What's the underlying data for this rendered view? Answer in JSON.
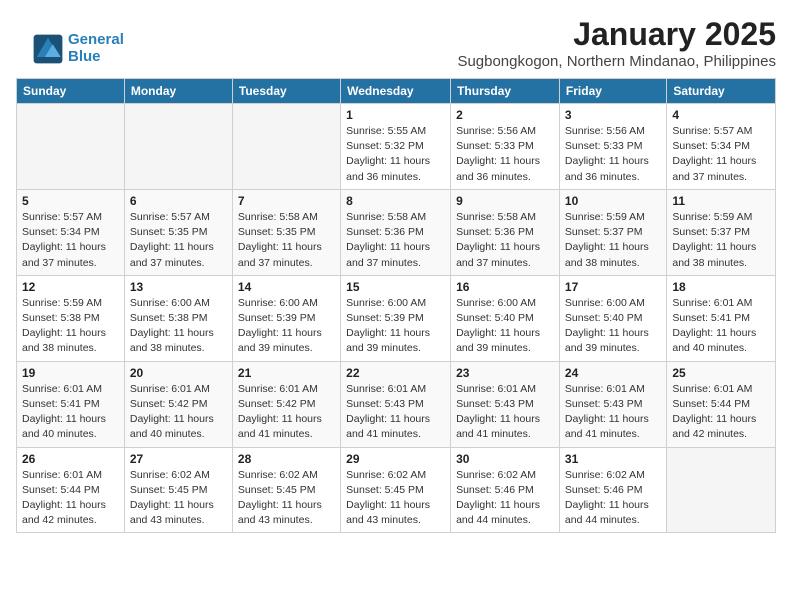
{
  "logo": {
    "line1": "General",
    "line2": "Blue"
  },
  "header": {
    "month_year": "January 2025",
    "location": "Sugbongkogon, Northern Mindanao, Philippines"
  },
  "weekdays": [
    "Sunday",
    "Monday",
    "Tuesday",
    "Wednesday",
    "Thursday",
    "Friday",
    "Saturday"
  ],
  "weeks": [
    [
      {
        "day": "",
        "sunrise": "",
        "sunset": "",
        "daylight": ""
      },
      {
        "day": "",
        "sunrise": "",
        "sunset": "",
        "daylight": ""
      },
      {
        "day": "",
        "sunrise": "",
        "sunset": "",
        "daylight": ""
      },
      {
        "day": "1",
        "sunrise": "Sunrise: 5:55 AM",
        "sunset": "Sunset: 5:32 PM",
        "daylight": "Daylight: 11 hours and 36 minutes."
      },
      {
        "day": "2",
        "sunrise": "Sunrise: 5:56 AM",
        "sunset": "Sunset: 5:33 PM",
        "daylight": "Daylight: 11 hours and 36 minutes."
      },
      {
        "day": "3",
        "sunrise": "Sunrise: 5:56 AM",
        "sunset": "Sunset: 5:33 PM",
        "daylight": "Daylight: 11 hours and 36 minutes."
      },
      {
        "day": "4",
        "sunrise": "Sunrise: 5:57 AM",
        "sunset": "Sunset: 5:34 PM",
        "daylight": "Daylight: 11 hours and 37 minutes."
      }
    ],
    [
      {
        "day": "5",
        "sunrise": "Sunrise: 5:57 AM",
        "sunset": "Sunset: 5:34 PM",
        "daylight": "Daylight: 11 hours and 37 minutes."
      },
      {
        "day": "6",
        "sunrise": "Sunrise: 5:57 AM",
        "sunset": "Sunset: 5:35 PM",
        "daylight": "Daylight: 11 hours and 37 minutes."
      },
      {
        "day": "7",
        "sunrise": "Sunrise: 5:58 AM",
        "sunset": "Sunset: 5:35 PM",
        "daylight": "Daylight: 11 hours and 37 minutes."
      },
      {
        "day": "8",
        "sunrise": "Sunrise: 5:58 AM",
        "sunset": "Sunset: 5:36 PM",
        "daylight": "Daylight: 11 hours and 37 minutes."
      },
      {
        "day": "9",
        "sunrise": "Sunrise: 5:58 AM",
        "sunset": "Sunset: 5:36 PM",
        "daylight": "Daylight: 11 hours and 37 minutes."
      },
      {
        "day": "10",
        "sunrise": "Sunrise: 5:59 AM",
        "sunset": "Sunset: 5:37 PM",
        "daylight": "Daylight: 11 hours and 38 minutes."
      },
      {
        "day": "11",
        "sunrise": "Sunrise: 5:59 AM",
        "sunset": "Sunset: 5:37 PM",
        "daylight": "Daylight: 11 hours and 38 minutes."
      }
    ],
    [
      {
        "day": "12",
        "sunrise": "Sunrise: 5:59 AM",
        "sunset": "Sunset: 5:38 PM",
        "daylight": "Daylight: 11 hours and 38 minutes."
      },
      {
        "day": "13",
        "sunrise": "Sunrise: 6:00 AM",
        "sunset": "Sunset: 5:38 PM",
        "daylight": "Daylight: 11 hours and 38 minutes."
      },
      {
        "day": "14",
        "sunrise": "Sunrise: 6:00 AM",
        "sunset": "Sunset: 5:39 PM",
        "daylight": "Daylight: 11 hours and 39 minutes."
      },
      {
        "day": "15",
        "sunrise": "Sunrise: 6:00 AM",
        "sunset": "Sunset: 5:39 PM",
        "daylight": "Daylight: 11 hours and 39 minutes."
      },
      {
        "day": "16",
        "sunrise": "Sunrise: 6:00 AM",
        "sunset": "Sunset: 5:40 PM",
        "daylight": "Daylight: 11 hours and 39 minutes."
      },
      {
        "day": "17",
        "sunrise": "Sunrise: 6:00 AM",
        "sunset": "Sunset: 5:40 PM",
        "daylight": "Daylight: 11 hours and 39 minutes."
      },
      {
        "day": "18",
        "sunrise": "Sunrise: 6:01 AM",
        "sunset": "Sunset: 5:41 PM",
        "daylight": "Daylight: 11 hours and 40 minutes."
      }
    ],
    [
      {
        "day": "19",
        "sunrise": "Sunrise: 6:01 AM",
        "sunset": "Sunset: 5:41 PM",
        "daylight": "Daylight: 11 hours and 40 minutes."
      },
      {
        "day": "20",
        "sunrise": "Sunrise: 6:01 AM",
        "sunset": "Sunset: 5:42 PM",
        "daylight": "Daylight: 11 hours and 40 minutes."
      },
      {
        "day": "21",
        "sunrise": "Sunrise: 6:01 AM",
        "sunset": "Sunset: 5:42 PM",
        "daylight": "Daylight: 11 hours and 41 minutes."
      },
      {
        "day": "22",
        "sunrise": "Sunrise: 6:01 AM",
        "sunset": "Sunset: 5:43 PM",
        "daylight": "Daylight: 11 hours and 41 minutes."
      },
      {
        "day": "23",
        "sunrise": "Sunrise: 6:01 AM",
        "sunset": "Sunset: 5:43 PM",
        "daylight": "Daylight: 11 hours and 41 minutes."
      },
      {
        "day": "24",
        "sunrise": "Sunrise: 6:01 AM",
        "sunset": "Sunset: 5:43 PM",
        "daylight": "Daylight: 11 hours and 41 minutes."
      },
      {
        "day": "25",
        "sunrise": "Sunrise: 6:01 AM",
        "sunset": "Sunset: 5:44 PM",
        "daylight": "Daylight: 11 hours and 42 minutes."
      }
    ],
    [
      {
        "day": "26",
        "sunrise": "Sunrise: 6:01 AM",
        "sunset": "Sunset: 5:44 PM",
        "daylight": "Daylight: 11 hours and 42 minutes."
      },
      {
        "day": "27",
        "sunrise": "Sunrise: 6:02 AM",
        "sunset": "Sunset: 5:45 PM",
        "daylight": "Daylight: 11 hours and 43 minutes."
      },
      {
        "day": "28",
        "sunrise": "Sunrise: 6:02 AM",
        "sunset": "Sunset: 5:45 PM",
        "daylight": "Daylight: 11 hours and 43 minutes."
      },
      {
        "day": "29",
        "sunrise": "Sunrise: 6:02 AM",
        "sunset": "Sunset: 5:45 PM",
        "daylight": "Daylight: 11 hours and 43 minutes."
      },
      {
        "day": "30",
        "sunrise": "Sunrise: 6:02 AM",
        "sunset": "Sunset: 5:46 PM",
        "daylight": "Daylight: 11 hours and 44 minutes."
      },
      {
        "day": "31",
        "sunrise": "Sunrise: 6:02 AM",
        "sunset": "Sunset: 5:46 PM",
        "daylight": "Daylight: 11 hours and 44 minutes."
      },
      {
        "day": "",
        "sunrise": "",
        "sunset": "",
        "daylight": ""
      }
    ]
  ]
}
